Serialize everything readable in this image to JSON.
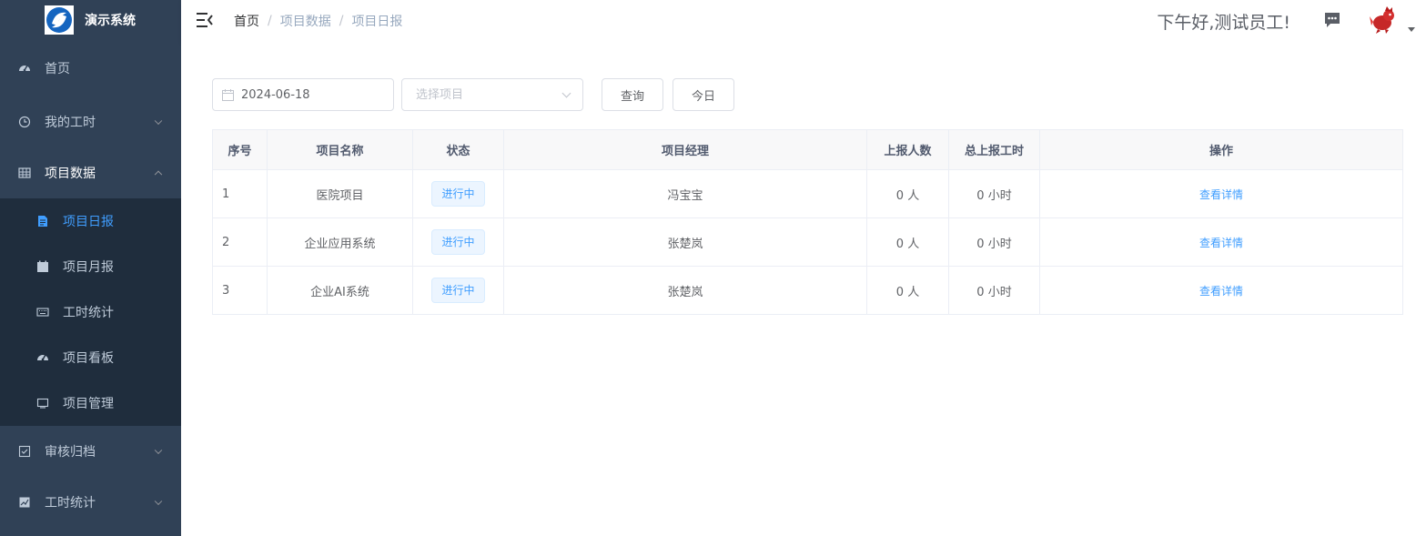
{
  "app": {
    "title": "演示系统"
  },
  "sidebar": {
    "items": [
      {
        "label": "首页",
        "icon": "dashboard-icon"
      },
      {
        "label": "我的工时",
        "icon": "clock-icon"
      },
      {
        "label": "项目数据",
        "icon": "table-icon"
      },
      {
        "label": "审核归档",
        "icon": "checkbox-icon"
      },
      {
        "label": "工时统计",
        "icon": "chart-icon"
      }
    ],
    "submenu": [
      {
        "label": "项目日报",
        "icon": "document-icon",
        "active": true
      },
      {
        "label": "项目月报",
        "icon": "calendar-icon"
      },
      {
        "label": "工时统计",
        "icon": "keyboard-icon"
      },
      {
        "label": "项目看板",
        "icon": "dashboard-icon"
      },
      {
        "label": "项目管理",
        "icon": "monitor-icon"
      }
    ]
  },
  "header": {
    "breadcrumb": [
      "首页",
      "项目数据",
      "项目日报"
    ],
    "greeting": "下午好,测试员工!"
  },
  "filters": {
    "date": "2024-06-18",
    "project_placeholder": "选择项目",
    "query_label": "查询",
    "today_label": "今日"
  },
  "table": {
    "headers": [
      "序号",
      "项目名称",
      "状态",
      "项目经理",
      "上报人数",
      "总上报工时",
      "操作"
    ],
    "rows": [
      {
        "index": "1",
        "name": "医院项目",
        "status": "进行中",
        "manager": "冯宝宝",
        "reporters": "0 人",
        "hours": "0 小时",
        "action": "查看详情"
      },
      {
        "index": "2",
        "name": "企业应用系统",
        "status": "进行中",
        "manager": "张楚岚",
        "reporters": "0 人",
        "hours": "0 小时",
        "action": "查看详情"
      },
      {
        "index": "3",
        "name": "企业AI系统",
        "status": "进行中",
        "manager": "张楚岚",
        "reporters": "0 人",
        "hours": "0 小时",
        "action": "查看详情"
      }
    ]
  },
  "colors": {
    "sidebar_bg": "#304156",
    "submenu_bg": "#1f2d3d",
    "accent": "#409eff"
  }
}
